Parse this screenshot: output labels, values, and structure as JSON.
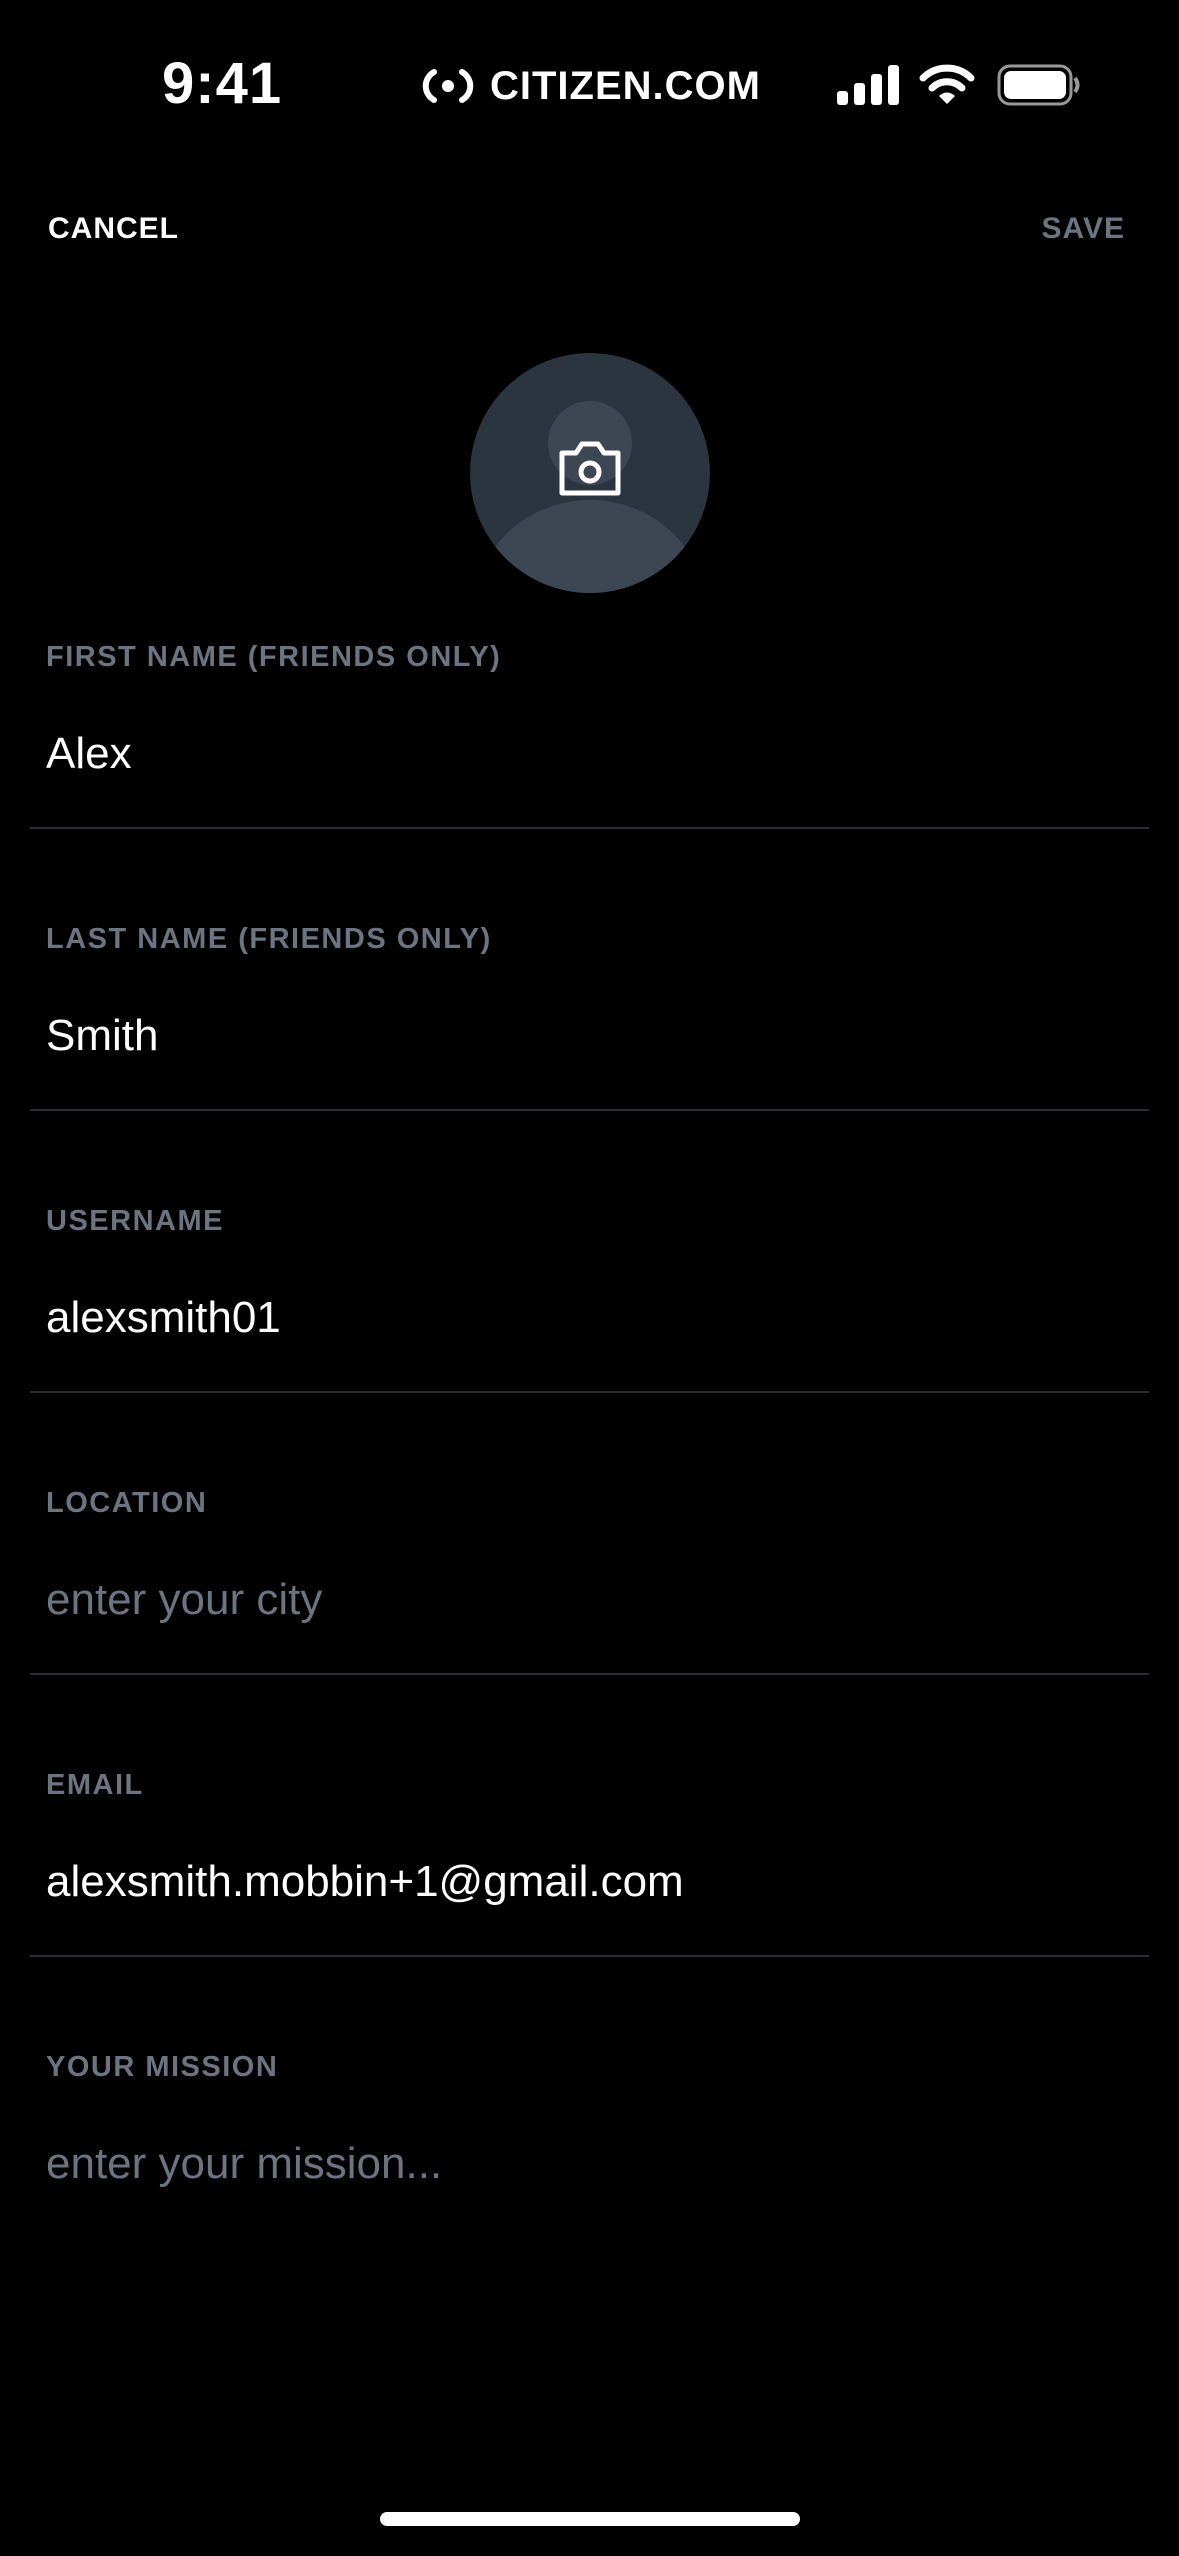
{
  "status_bar": {
    "time": "9:41",
    "carrier": "CITIZEN.COM",
    "icons": [
      "signal-icon",
      "wifi-icon",
      "battery-icon"
    ]
  },
  "nav": {
    "cancel_label": "CANCEL",
    "save_label": "SAVE"
  },
  "avatar": {
    "icon": "camera-icon"
  },
  "fields": [
    {
      "label": "FIRST NAME (FRIENDS ONLY)",
      "value": "Alex",
      "placeholder": ""
    },
    {
      "label": "LAST NAME (FRIENDS ONLY)",
      "value": "Smith",
      "placeholder": ""
    },
    {
      "label": "USERNAME",
      "value": "alexsmith01",
      "placeholder": ""
    },
    {
      "label": "LOCATION",
      "value": "",
      "placeholder": "enter your city"
    },
    {
      "label": "EMAIL",
      "value": "alexsmith.mobbin+1@gmail.com",
      "placeholder": ""
    },
    {
      "label": "YOUR MISSION",
      "value": "",
      "placeholder": "enter your mission..."
    }
  ],
  "colors": {
    "background": "#000000",
    "label": "#6b7480",
    "save_disabled": "#6b7480",
    "divider": "#2a2d31",
    "avatar_bg": "#2b3540",
    "avatar_figure": "#3c4753"
  }
}
